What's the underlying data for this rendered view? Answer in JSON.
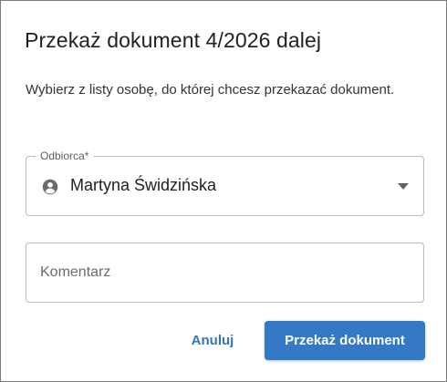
{
  "dialog": {
    "title": "Przekaż dokument 4/2026 dalej",
    "description": "Wybierz z listy osobę, do której chcesz przekazać dokument."
  },
  "recipient": {
    "label": "Odbiorca*",
    "value": "Martyna Świdzińska",
    "icon": "person-circle-icon",
    "dropdown_icon": "arrow-drop-down-icon"
  },
  "comment": {
    "placeholder": "Komentarz",
    "value": ""
  },
  "actions": {
    "cancel_label": "Anuluj",
    "submit_label": "Przekaż dokument"
  },
  "colors": {
    "accent": "#3479c6",
    "link": "#3275c4",
    "border": "#bdbdbd"
  }
}
